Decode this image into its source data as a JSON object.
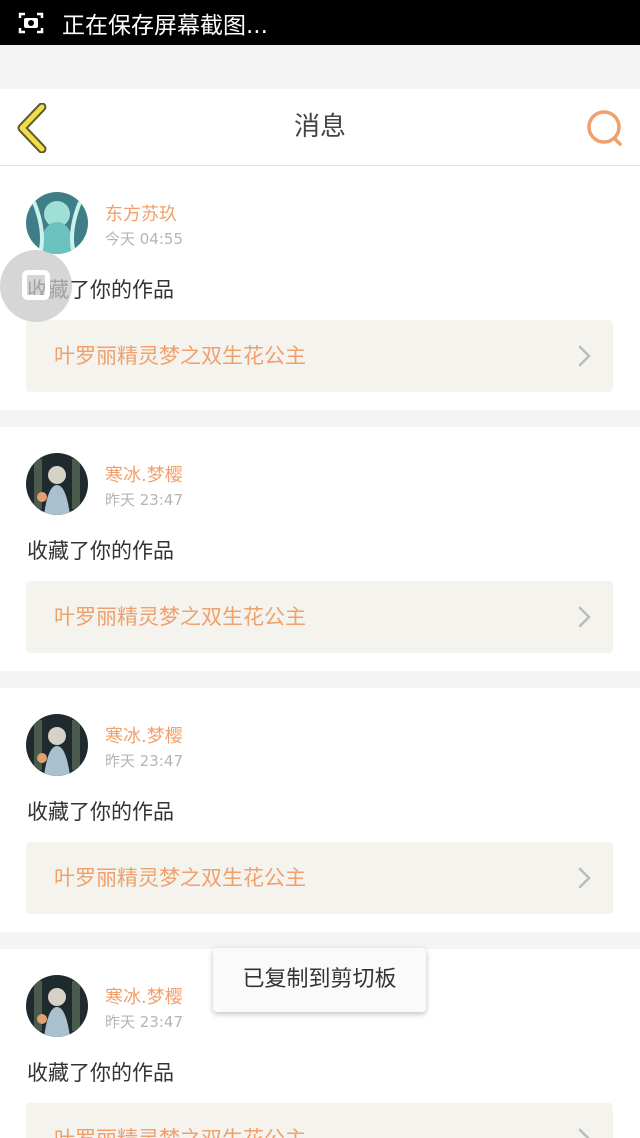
{
  "status_bar": {
    "text": "正在保存屏幕截图..."
  },
  "header": {
    "title": "消息",
    "back_icon": "chevron-left-icon",
    "search_icon": "search-icon"
  },
  "accent_color": "#f0a06c",
  "messages": [
    {
      "username": "东方苏玖",
      "time": "今天 04:55",
      "action": "收藏了你的作品",
      "work_title": "叶罗丽精灵梦之双生花公主"
    },
    {
      "username": "寒冰.梦樱",
      "time": "昨天 23:47",
      "action": "收藏了你的作品",
      "work_title": "叶罗丽精灵梦之双生花公主"
    },
    {
      "username": "寒冰.梦樱",
      "time": "昨天 23:47",
      "action": "收藏了你的作品",
      "work_title": "叶罗丽精灵梦之双生花公主"
    },
    {
      "username": "寒冰.梦樱",
      "time": "昨天 23:47",
      "action": "收藏了你的作品",
      "work_title": "叶罗丽精灵梦之双生花公主"
    }
  ],
  "toast": {
    "text": "已复制到剪切板"
  }
}
